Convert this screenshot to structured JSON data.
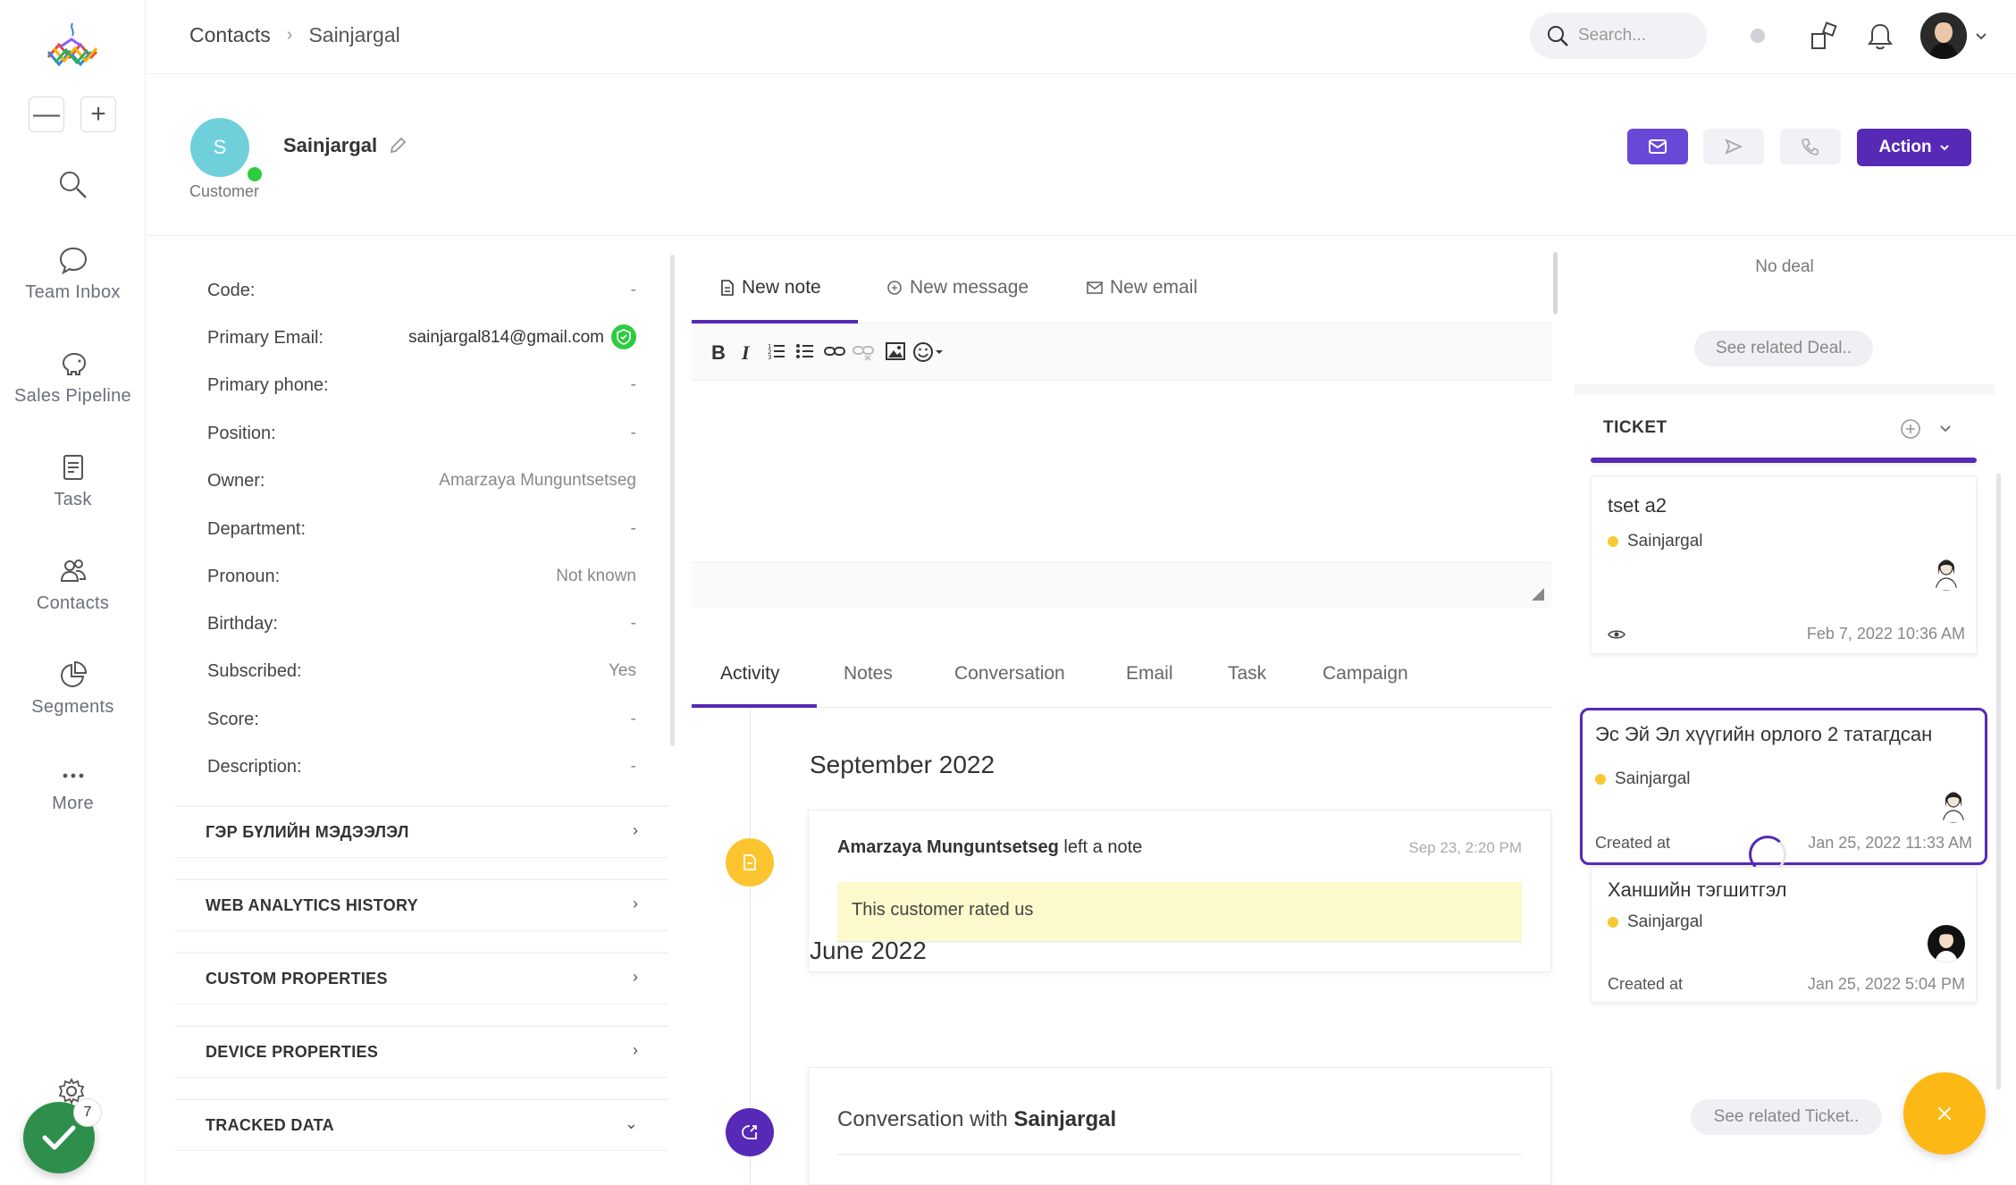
{
  "sidebar": {
    "items": [
      {
        "label": "",
        "icon": "search-icon"
      },
      {
        "label": "Team Inbox",
        "icon": "chat-bubble-icon"
      },
      {
        "label": "Sales Pipeline",
        "icon": "piggy-bank-icon"
      },
      {
        "label": "Task",
        "icon": "task-list-icon"
      },
      {
        "label": "Contacts",
        "icon": "contacts-icon"
      },
      {
        "label": "Segments",
        "icon": "pie-chart-icon"
      },
      {
        "label": "More",
        "icon": "more-dots-icon"
      }
    ],
    "zoom_out": "—",
    "zoom_in": "+",
    "notification_count": "7"
  },
  "breadcrumb": {
    "parent": "Contacts",
    "separator": "›",
    "current": "Sainjargal"
  },
  "search": {
    "placeholder": "Search..."
  },
  "contact": {
    "initial": "S",
    "name": "Sainjargal",
    "type": "Customer"
  },
  "header_actions": {
    "action_label": "Action",
    "action_caret": "⌄"
  },
  "info": {
    "rows": [
      {
        "label": "Code:",
        "value": "-"
      },
      {
        "label": "Primary Email:",
        "value": "sainjargal814@gmail.com"
      },
      {
        "label": "Primary phone:",
        "value": "-"
      },
      {
        "label": "Position:",
        "value": "-"
      },
      {
        "label": "Owner:",
        "value": "Amarzaya Munguntsetseg"
      },
      {
        "label": "Department:",
        "value": "-"
      },
      {
        "label": "Pronoun:",
        "value": "Not known"
      },
      {
        "label": "Birthday:",
        "value": "-"
      },
      {
        "label": "Subscribed:",
        "value": "Yes"
      },
      {
        "label": "Score:",
        "value": "-"
      },
      {
        "label": "Description:",
        "value": "-"
      }
    ],
    "sections": [
      {
        "label": "ГЭР БҮЛИЙН МЭДЭЭЛЭЛ",
        "chevron": "›"
      },
      {
        "label": "WEB ANALYTICS HISTORY",
        "chevron": "›"
      },
      {
        "label": "CUSTOM PROPERTIES",
        "chevron": "›"
      },
      {
        "label": "DEVICE PROPERTIES",
        "chevron": "›"
      },
      {
        "label": "TRACKED DATA",
        "chevron": "⌄"
      }
    ]
  },
  "editor": {
    "tabs": [
      "New note",
      "New message",
      "New email"
    ],
    "toolbar": {
      "bold": "B",
      "italic": "I"
    }
  },
  "activity": {
    "tabs": [
      "Activity",
      "Notes",
      "Conversation",
      "Email",
      "Task",
      "Campaign"
    ],
    "months": [
      "September 2022",
      "June 2022"
    ],
    "note": {
      "author": "Amarzaya Munguntsetseg",
      "action": "left a note",
      "time": "Sep 23, 2:20 PM",
      "body": "This customer rated us"
    },
    "conversation": {
      "prefix": "Conversation with",
      "name": "Sainjargal"
    }
  },
  "right": {
    "no_deal": "No deal",
    "see_deal": "See related Deal..",
    "ticket_header": "TICKET",
    "see_ticket": "See related Ticket..",
    "tickets": [
      {
        "title": "tset a2",
        "user": "Sainjargal",
        "created_label": "",
        "date": "Feb 7, 2022 10:36 AM"
      },
      {
        "title": "Эс Эй Эл хүүгийн орлого 2 татагдсан",
        "user": "Sainjargal",
        "created_label": "Created at",
        "date": "Jan 25, 2022 11:33 AM"
      },
      {
        "title": "Ханшийн тэгшитгэл",
        "user": "Sainjargal",
        "created_label": "Created at",
        "date": "Jan 25, 2022 5:04 PM"
      }
    ]
  },
  "colors": {
    "primary": "#5629b6",
    "email_button": "#6a48d7",
    "online": "#2ecc40",
    "avatar": "#6fd0dc",
    "note_bg": "#fcf9cc",
    "fab": "#fcb814",
    "check_button": "#2e8f4d"
  }
}
